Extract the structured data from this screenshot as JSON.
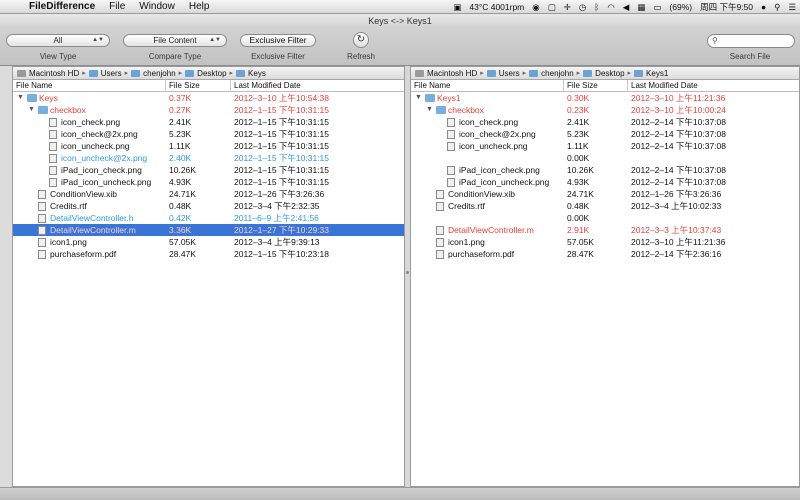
{
  "menubar": {
    "app_name": "FileDifference",
    "items": [
      "File",
      "Window",
      "Help"
    ],
    "status": {
      "temp": "43°C 4001rpm",
      "battery": "(69%)",
      "clock": "周四 下午9:50"
    }
  },
  "window": {
    "title": "Keys <-> Keys1"
  },
  "toolbar": {
    "view_type_value": "All",
    "view_type_label": "View Type",
    "compare_type_value": "File Content",
    "compare_type_label": "Compare Type",
    "exclusive_filter_button": "Exclusive Filter",
    "exclusive_filter_label": "Exclusive Filter",
    "refresh_label": "Refresh",
    "search_label": "Search File",
    "search_placeholder": ""
  },
  "columns": {
    "name": "File Name",
    "size": "File Size",
    "date": "Last Modified Date"
  },
  "left": {
    "path": [
      "Macintosh HD",
      "Users",
      "chenjohn",
      "Desktop",
      "Keys"
    ],
    "rows": [
      {
        "name": "Keys",
        "size": "0.37K",
        "date": "2012–3–10 上午10:54:38",
        "color": "red",
        "type": "dir",
        "level": 0,
        "tri": "▼"
      },
      {
        "name": "checkbox",
        "size": "0.27K",
        "date": "2012–1–15 下午10:31:15",
        "color": "red",
        "type": "dir",
        "level": 1,
        "tri": "▼"
      },
      {
        "name": "icon_check.png",
        "size": "2.41K",
        "date": "2012–1–15 下午10:31:15",
        "color": "",
        "type": "file",
        "level": 2
      },
      {
        "name": "icon_check@2x.png",
        "size": "5.23K",
        "date": "2012–1–15 下午10:31:15",
        "color": "",
        "type": "file",
        "level": 2
      },
      {
        "name": "icon_uncheck.png",
        "size": "1.11K",
        "date": "2012–1–15 下午10:31:15",
        "color": "",
        "type": "file",
        "level": 2
      },
      {
        "name": "icon_uncheck@2x.png",
        "size": "2.40K",
        "date": "2012–1–15 下午10:31:15",
        "color": "blue",
        "type": "file",
        "level": 2
      },
      {
        "name": "iPad_icon_check.png",
        "size": "10.26K",
        "date": "2012–1–15 下午10:31:15",
        "color": "",
        "type": "file",
        "level": 2
      },
      {
        "name": "iPad_icon_uncheck.png",
        "size": "4.93K",
        "date": "2012–1–15 下午10:31:15",
        "color": "",
        "type": "file",
        "level": 2
      },
      {
        "name": "ConditionView.xib",
        "size": "24.71K",
        "date": "2012–1–26 下午3:26:36",
        "color": "",
        "type": "file",
        "level": 1
      },
      {
        "name": "Credits.rtf",
        "size": "0.48K",
        "date": "2012–3–4 下午2:32:35",
        "color": "",
        "type": "file",
        "level": 1
      },
      {
        "name": "DetailViewController.h",
        "size": "0.42K",
        "date": "2011–6–9 上午2:41:56",
        "color": "blue",
        "type": "file",
        "level": 1
      },
      {
        "name": "DetailViewController.m",
        "size": "3.36K",
        "date": "2012–1–27 下午10:29:33",
        "color": "red",
        "type": "file",
        "level": 1,
        "selected": true
      },
      {
        "name": "icon1.png",
        "size": "57.05K",
        "date": "2012–3–4 上午9:39:13",
        "color": "",
        "type": "file",
        "level": 1
      },
      {
        "name": "purchaseform.pdf",
        "size": "28.47K",
        "date": "2012–1–15 下午10:23:18",
        "color": "",
        "type": "file",
        "level": 1
      }
    ]
  },
  "right": {
    "path": [
      "Macintosh HD",
      "Users",
      "chenjohn",
      "Desktop",
      "Keys1"
    ],
    "rows": [
      {
        "name": "Keys1",
        "size": "0.30K",
        "date": "2012–3–10 上午11:21:36",
        "color": "red",
        "type": "dir",
        "level": 0,
        "tri": "▼"
      },
      {
        "name": "checkbox",
        "size": "0.23K",
        "date": "2012–3–10 上午10:00:24",
        "color": "red",
        "type": "dir",
        "level": 1,
        "tri": "▼"
      },
      {
        "name": "icon_check.png",
        "size": "2.41K",
        "date": "2012–2–14 下午10:37:08",
        "color": "",
        "type": "file",
        "level": 2
      },
      {
        "name": "icon_check@2x.png",
        "size": "5.23K",
        "date": "2012–2–14 下午10:37:08",
        "color": "",
        "type": "file",
        "level": 2
      },
      {
        "name": "icon_uncheck.png",
        "size": "1.11K",
        "date": "2012–2–14 下午10:37:08",
        "color": "",
        "type": "file",
        "level": 2
      },
      {
        "name": "",
        "size": "0.00K",
        "date": "",
        "color": "",
        "type": "empty",
        "level": 2
      },
      {
        "name": "iPad_icon_check.png",
        "size": "10.26K",
        "date": "2012–2–14 下午10:37:08",
        "color": "",
        "type": "file",
        "level": 2
      },
      {
        "name": "iPad_icon_uncheck.png",
        "size": "4.93K",
        "date": "2012–2–14 下午10:37:08",
        "color": "",
        "type": "file",
        "level": 2
      },
      {
        "name": "ConditionView.xib",
        "size": "24.71K",
        "date": "2012–1–26 下午3:26:36",
        "color": "",
        "type": "file",
        "level": 1
      },
      {
        "name": "Credits.rtf",
        "size": "0.48K",
        "date": "2012–3–4 上午10:02:33",
        "color": "",
        "type": "file",
        "level": 1
      },
      {
        "name": "",
        "size": "0.00K",
        "date": "",
        "color": "",
        "type": "empty",
        "level": 1
      },
      {
        "name": "DetailViewController.m",
        "size": "2.91K",
        "date": "2012–3–3 上午10:37:43",
        "color": "red",
        "type": "file",
        "level": 1
      },
      {
        "name": "icon1.png",
        "size": "57.05K",
        "date": "2012–3–10 上午11:21:36",
        "color": "",
        "type": "file",
        "level": 1
      },
      {
        "name": "purchaseform.pdf",
        "size": "28.47K",
        "date": "2012–2–14 下午2:36:16",
        "color": "",
        "type": "file",
        "level": 1
      }
    ]
  },
  "colors": {
    "changed": "#e8403a",
    "unique": "#2f9be0",
    "selection": "#3875d7"
  }
}
